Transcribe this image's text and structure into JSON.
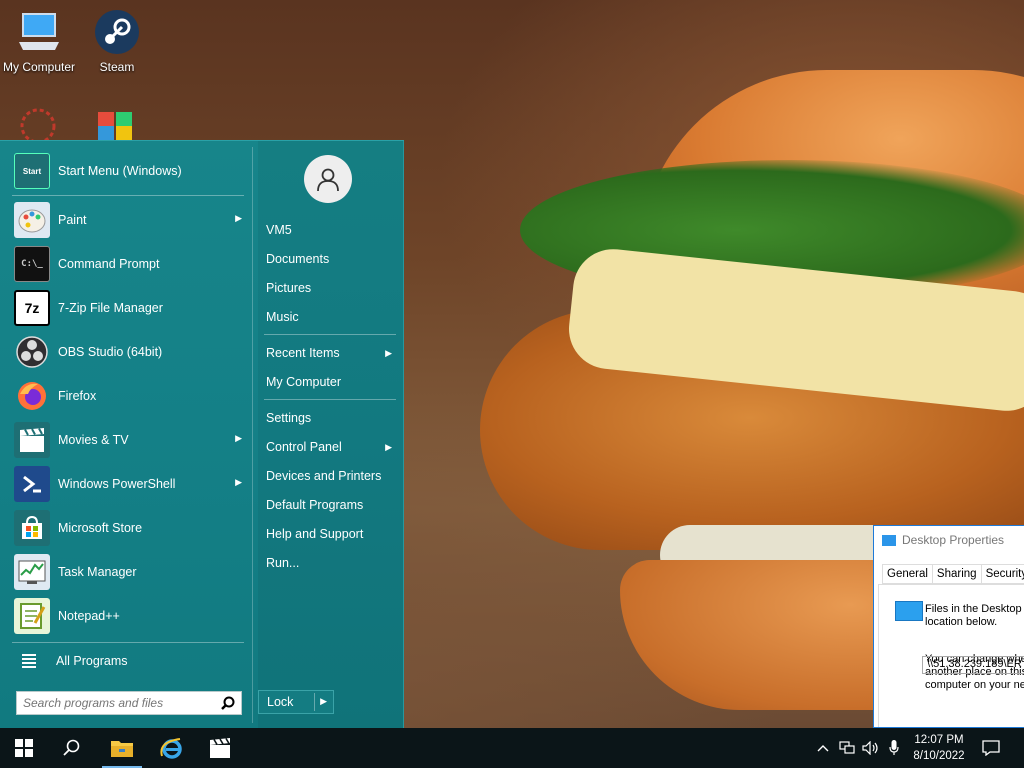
{
  "desktop": {
    "icons": [
      {
        "label": "My Computer"
      },
      {
        "label": "Steam"
      }
    ]
  },
  "start_menu": {
    "programs": [
      {
        "label": "Start Menu (Windows)",
        "icon": "start-menu-icon",
        "has_submenu": false
      },
      {
        "label": "Paint",
        "icon": "paint-icon",
        "has_submenu": true
      },
      {
        "label": "Command Prompt",
        "icon": "command-prompt-icon",
        "has_submenu": false
      },
      {
        "label": "7-Zip File Manager",
        "icon": "7zip-icon",
        "has_submenu": false
      },
      {
        "label": "OBS Studio (64bit)",
        "icon": "obs-icon",
        "has_submenu": false
      },
      {
        "label": "Firefox",
        "icon": "firefox-icon",
        "has_submenu": false
      },
      {
        "label": "Movies & TV",
        "icon": "movies-tv-icon",
        "has_submenu": true
      },
      {
        "label": "Windows PowerShell",
        "icon": "powershell-icon",
        "has_submenu": true
      },
      {
        "label": "Microsoft Store",
        "icon": "store-icon",
        "has_submenu": false
      },
      {
        "label": "Task Manager",
        "icon": "task-manager-icon",
        "has_submenu": false
      },
      {
        "label": "Notepad++",
        "icon": "notepadpp-icon",
        "has_submenu": false
      }
    ],
    "start_icon_text": "Start",
    "all_programs": "All Programs",
    "search": {
      "placeholder": "Search programs and files"
    },
    "right": {
      "user": "VM5",
      "documents": "Documents",
      "pictures": "Pictures",
      "music": "Music",
      "recent_items": "Recent Items",
      "my_computer": "My Computer",
      "settings": "Settings",
      "control_panel": "Control Panel",
      "devices_printers": "Devices and Printers",
      "default_programs": "Default Programs",
      "help_support": "Help and Support",
      "run": "Run..."
    },
    "lock": "Lock"
  },
  "properties_window": {
    "title": "Desktop Properties",
    "tabs": [
      "General",
      "Sharing",
      "Security"
    ],
    "line1": "Files in the Desktop fo",
    "line2": "location below.",
    "line3": "You can change whe",
    "line4": "another place on this",
    "line5": "computer on your net",
    "path": "\\\\51.38.239.189\\ER"
  },
  "taskbar": {
    "time": "12:07 PM",
    "date": "8/10/2022"
  }
}
